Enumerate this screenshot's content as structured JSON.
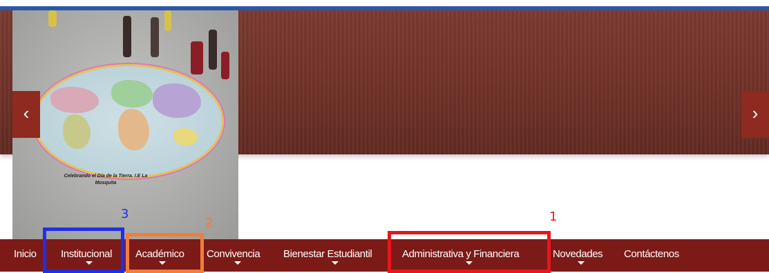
{
  "slider": {
    "prev_icon": "chevron-left-icon",
    "next_icon": "chevron-right-icon",
    "prev_glyph": "‹",
    "next_glyph": "›",
    "caption_line1": "Celebrando el Día de la Tierra. I.E La",
    "caption_line2": "Mosquita"
  },
  "nav": {
    "items": [
      {
        "label": "Inicio",
        "has_dropdown": false
      },
      {
        "label": "Institucional",
        "has_dropdown": true
      },
      {
        "label": "Académico",
        "has_dropdown": true
      },
      {
        "label": "Convivencia",
        "has_dropdown": true
      },
      {
        "label": "Bienestar Estudiantil",
        "has_dropdown": true
      },
      {
        "label": "Administrativa y Financiera",
        "has_dropdown": true
      },
      {
        "label": "Novedades",
        "has_dropdown": true
      },
      {
        "label": "Contáctenos",
        "has_dropdown": false
      }
    ]
  },
  "annotations": [
    {
      "number": "1",
      "color": "#e8161b"
    },
    {
      "number": "2",
      "color": "#f07d3a"
    },
    {
      "number": "3",
      "color": "#1f2fe6"
    }
  ],
  "colors": {
    "nav_bg": "#7c1a17",
    "slider_bg": "#6d3026",
    "top_line": "#2b58a8"
  }
}
